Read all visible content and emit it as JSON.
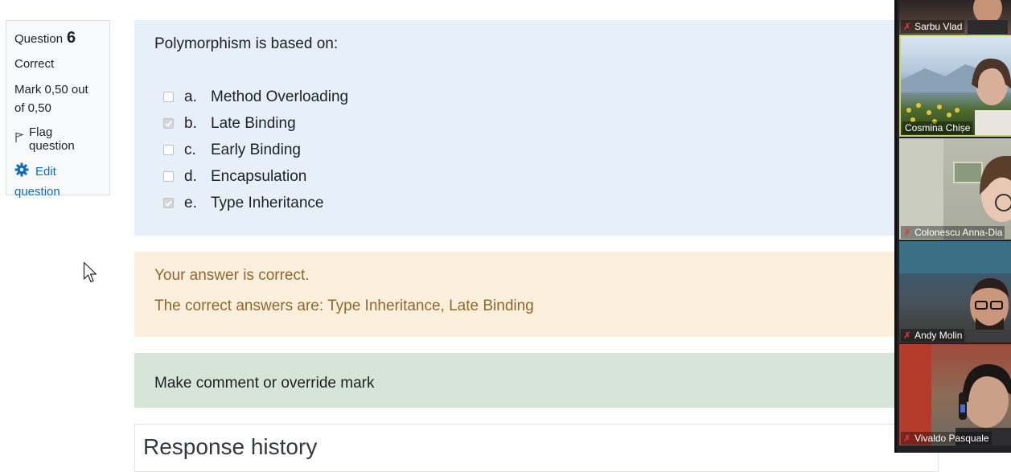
{
  "question_info": {
    "label": "Question",
    "number": "6",
    "state": "Correct",
    "grade": "Mark 0,50 out of 0,50",
    "flag_label": "Flag question",
    "edit_label": "Edit question"
  },
  "question": {
    "text": "Polymorphism is based on:",
    "answers": [
      {
        "letter": "a.",
        "text": "Method Overloading",
        "checked": false
      },
      {
        "letter": "b.",
        "text": "Late Binding",
        "checked": true
      },
      {
        "letter": "c.",
        "text": "Early Binding",
        "checked": false
      },
      {
        "letter": "d.",
        "text": "Encapsulation",
        "checked": false
      },
      {
        "letter": "e.",
        "text": "Type Inheritance",
        "checked": true
      }
    ]
  },
  "feedback": {
    "specific": "Your answer is correct.",
    "right_answer": "The correct answers are: Type Inheritance, Late Binding"
  },
  "comment": {
    "link_label": "Make comment or override mark"
  },
  "history": {
    "title": "Response history"
  },
  "video_call": {
    "participants": [
      {
        "name": "Sarbu Vlad",
        "muted": true
      },
      {
        "name": "Cosmina Chișe",
        "muted": false
      },
      {
        "name": "Colonescu Anna-Dia",
        "muted": true
      },
      {
        "name": "Andy Molin",
        "muted": true
      },
      {
        "name": "Vivaldo Pasquale",
        "muted": true
      }
    ]
  },
  "colors": {
    "formulation_bg": "#e7f0f8",
    "feedback_bg": "#fcefdc",
    "feedback_text": "#8e662e",
    "comment_bg": "#d7e4d8",
    "link": "#0f6cbf"
  }
}
